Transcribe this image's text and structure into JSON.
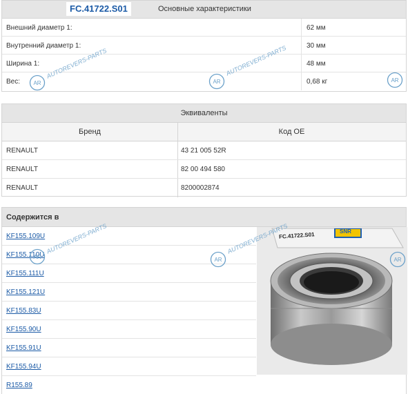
{
  "part_code": "FC.41722.S01",
  "specs": {
    "title": "Основные характеристики",
    "rows": [
      {
        "label": "Внешний диаметр 1:",
        "value": "62 мм"
      },
      {
        "label": "Внутренний диаметр 1:",
        "value": "30 мм"
      },
      {
        "label": "Ширина 1:",
        "value": "48 мм"
      },
      {
        "label": "Вес:",
        "value": "0,68 кг"
      }
    ]
  },
  "equivalents": {
    "title": "Эквиваленты",
    "columns": {
      "brand": "Бренд",
      "oe": "Код ОЕ"
    },
    "rows": [
      {
        "brand": "RENAULT",
        "oe": "43 21 005 52R"
      },
      {
        "brand": "RENAULT",
        "oe": "82 00 494 580"
      },
      {
        "brand": "RENAULT",
        "oe": "8200002874"
      }
    ]
  },
  "contained": {
    "title": "Содержится в",
    "kits": [
      "KF155.109U",
      "KF155.110U",
      "KF155.111U",
      "KF155.121U",
      "KF155.83U",
      "KF155.90U",
      "KF155.91U",
      "KF155.94U",
      "R155.89"
    ]
  },
  "product_image": {
    "box_label": "FC.41722.S01",
    "brand_mark": "SNR"
  },
  "watermark": {
    "text": "AUTOREVERS-PARTS",
    "logo_text": "AR",
    "color": "#6aa0c9"
  },
  "colors": {
    "link": "#1b5aa6",
    "header_bg": "#e5e5e5",
    "border": "#d4d4d4"
  }
}
